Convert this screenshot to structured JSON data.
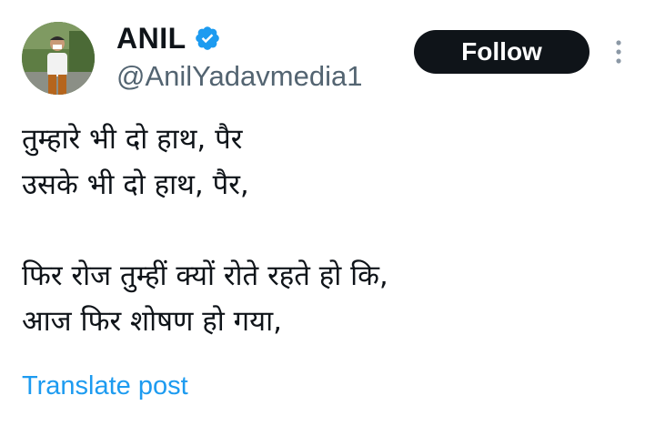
{
  "user": {
    "display_name": "ANIL",
    "handle": "@AnilYadavmedia1",
    "verified": true,
    "avatar_icon": "profile-photo"
  },
  "actions": {
    "follow_label": "Follow",
    "more_icon": "vertical-ellipsis-icon"
  },
  "post": {
    "lines": [
      "तुम्हारे भी दो हाथ, पैर",
      "उसके भी दो हाथ, पैर,",
      "",
      "फिर रोज तुम्हीं क्यों रोते रहते हो कि,",
      "आज फिर शोषण हो गया,"
    ]
  },
  "translate_label": "Translate post",
  "colors": {
    "text": "#0f1419",
    "secondary": "#536471",
    "link": "#1d9bf0",
    "verified": "#1d9bf0",
    "button_bg": "#0f1419",
    "button_text": "#ffffff"
  }
}
